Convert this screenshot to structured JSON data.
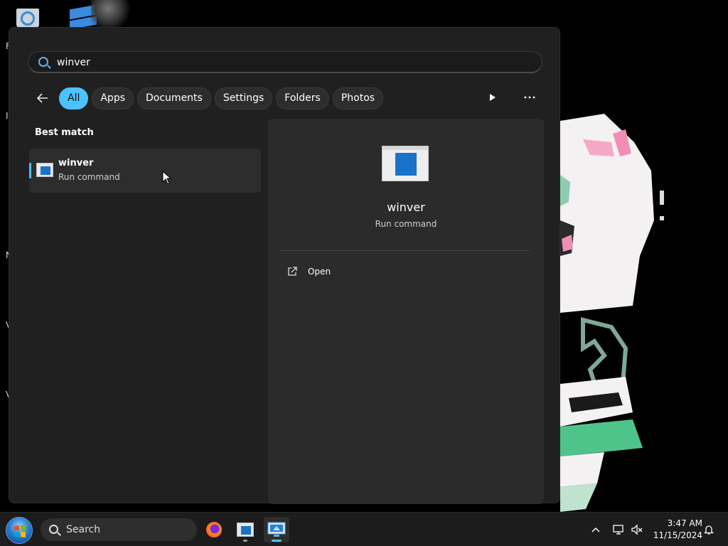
{
  "desktop": {
    "edge_letters": [
      "F",
      "I",
      "N",
      "V",
      "V"
    ]
  },
  "search": {
    "query": "winver"
  },
  "filters": {
    "back_label": "Back",
    "chips": [
      "All",
      "Apps",
      "Documents",
      "Settings",
      "Folders",
      "Photos"
    ],
    "active": "All"
  },
  "best_match": {
    "title": "Best match",
    "name": "winver",
    "type": "Run command"
  },
  "preview": {
    "name": "winver",
    "type": "Run command",
    "actions": [
      "Open"
    ]
  },
  "taskbar": {
    "search_label": "Search",
    "time": "3:47 AM",
    "date": "11/15/2024"
  },
  "colors": {
    "accent": "#4cc2ff",
    "menu_bg": "#202020",
    "panel_bg": "#2b2b2b"
  }
}
